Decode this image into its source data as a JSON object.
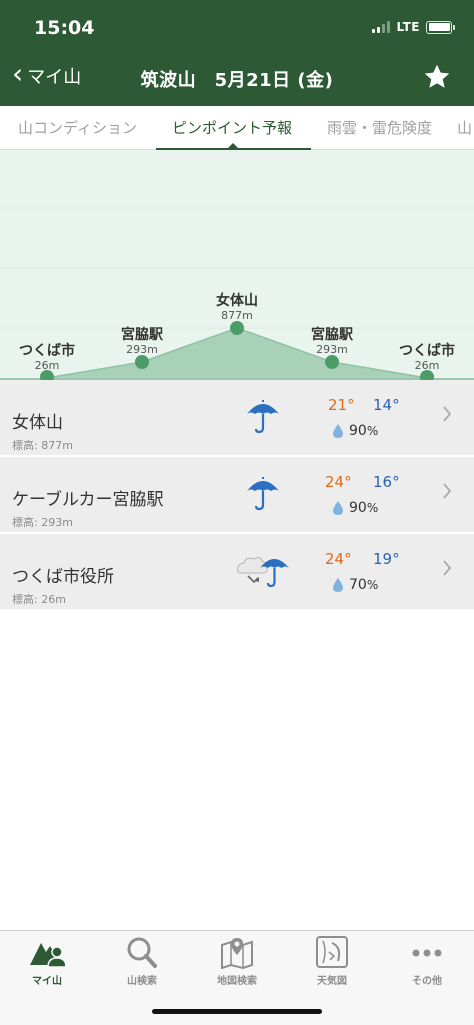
{
  "status_bar": {
    "time": "15:04",
    "network": "LTE"
  },
  "header": {
    "back_label": "マイ山",
    "title": "筑波山　5月21日 (金)"
  },
  "tabs": [
    {
      "label": "山コンディション",
      "active": false
    },
    {
      "label": "ピンポイント予報",
      "active": true
    },
    {
      "label": "雨雲・雷危険度",
      "active": false
    },
    {
      "label": "山",
      "active": false
    }
  ],
  "profile": {
    "points": [
      {
        "name": "つくば市",
        "alt": "26m"
      },
      {
        "name": "宮脇駅",
        "alt": "293m"
      },
      {
        "name": "女体山",
        "alt": "877m"
      },
      {
        "name": "宮脇駅",
        "alt": "293m"
      },
      {
        "name": "つくば市",
        "alt": "26m"
      }
    ]
  },
  "forecast_rows": [
    {
      "name": "女体山",
      "alt_label": "標高: 877m",
      "icon": "umbrella-rain-icon",
      "max": "21°",
      "min": "14°",
      "rain": "90",
      "rain_unit": "%"
    },
    {
      "name": "ケーブルカー宮脇駅",
      "alt_label": "標高: 293m",
      "icon": "umbrella-rain-icon",
      "max": "24°",
      "min": "16°",
      "rain": "90",
      "rain_unit": "%"
    },
    {
      "name": "つくば市役所",
      "alt_label": "標高: 26m",
      "icon": "cloudy-then-rain-icon",
      "max": "24°",
      "min": "19°",
      "rain": "70",
      "rain_unit": "%"
    }
  ],
  "bottom_nav": [
    {
      "label": "マイ山",
      "icon": "my-mountain-icon",
      "active": true
    },
    {
      "label": "山検索",
      "icon": "search-icon",
      "active": false
    },
    {
      "label": "地図検索",
      "icon": "map-icon",
      "active": false
    },
    {
      "label": "天気図",
      "icon": "weather-map-icon",
      "active": false
    },
    {
      "label": "その他",
      "icon": "more-icon",
      "active": false
    }
  ],
  "colors": {
    "header": "#2d5a34",
    "temp_max": "#e06a1b",
    "temp_min": "#2a63b0",
    "profile_fill": "#a9d1b8",
    "profile_dot": "#4e9b6a"
  }
}
